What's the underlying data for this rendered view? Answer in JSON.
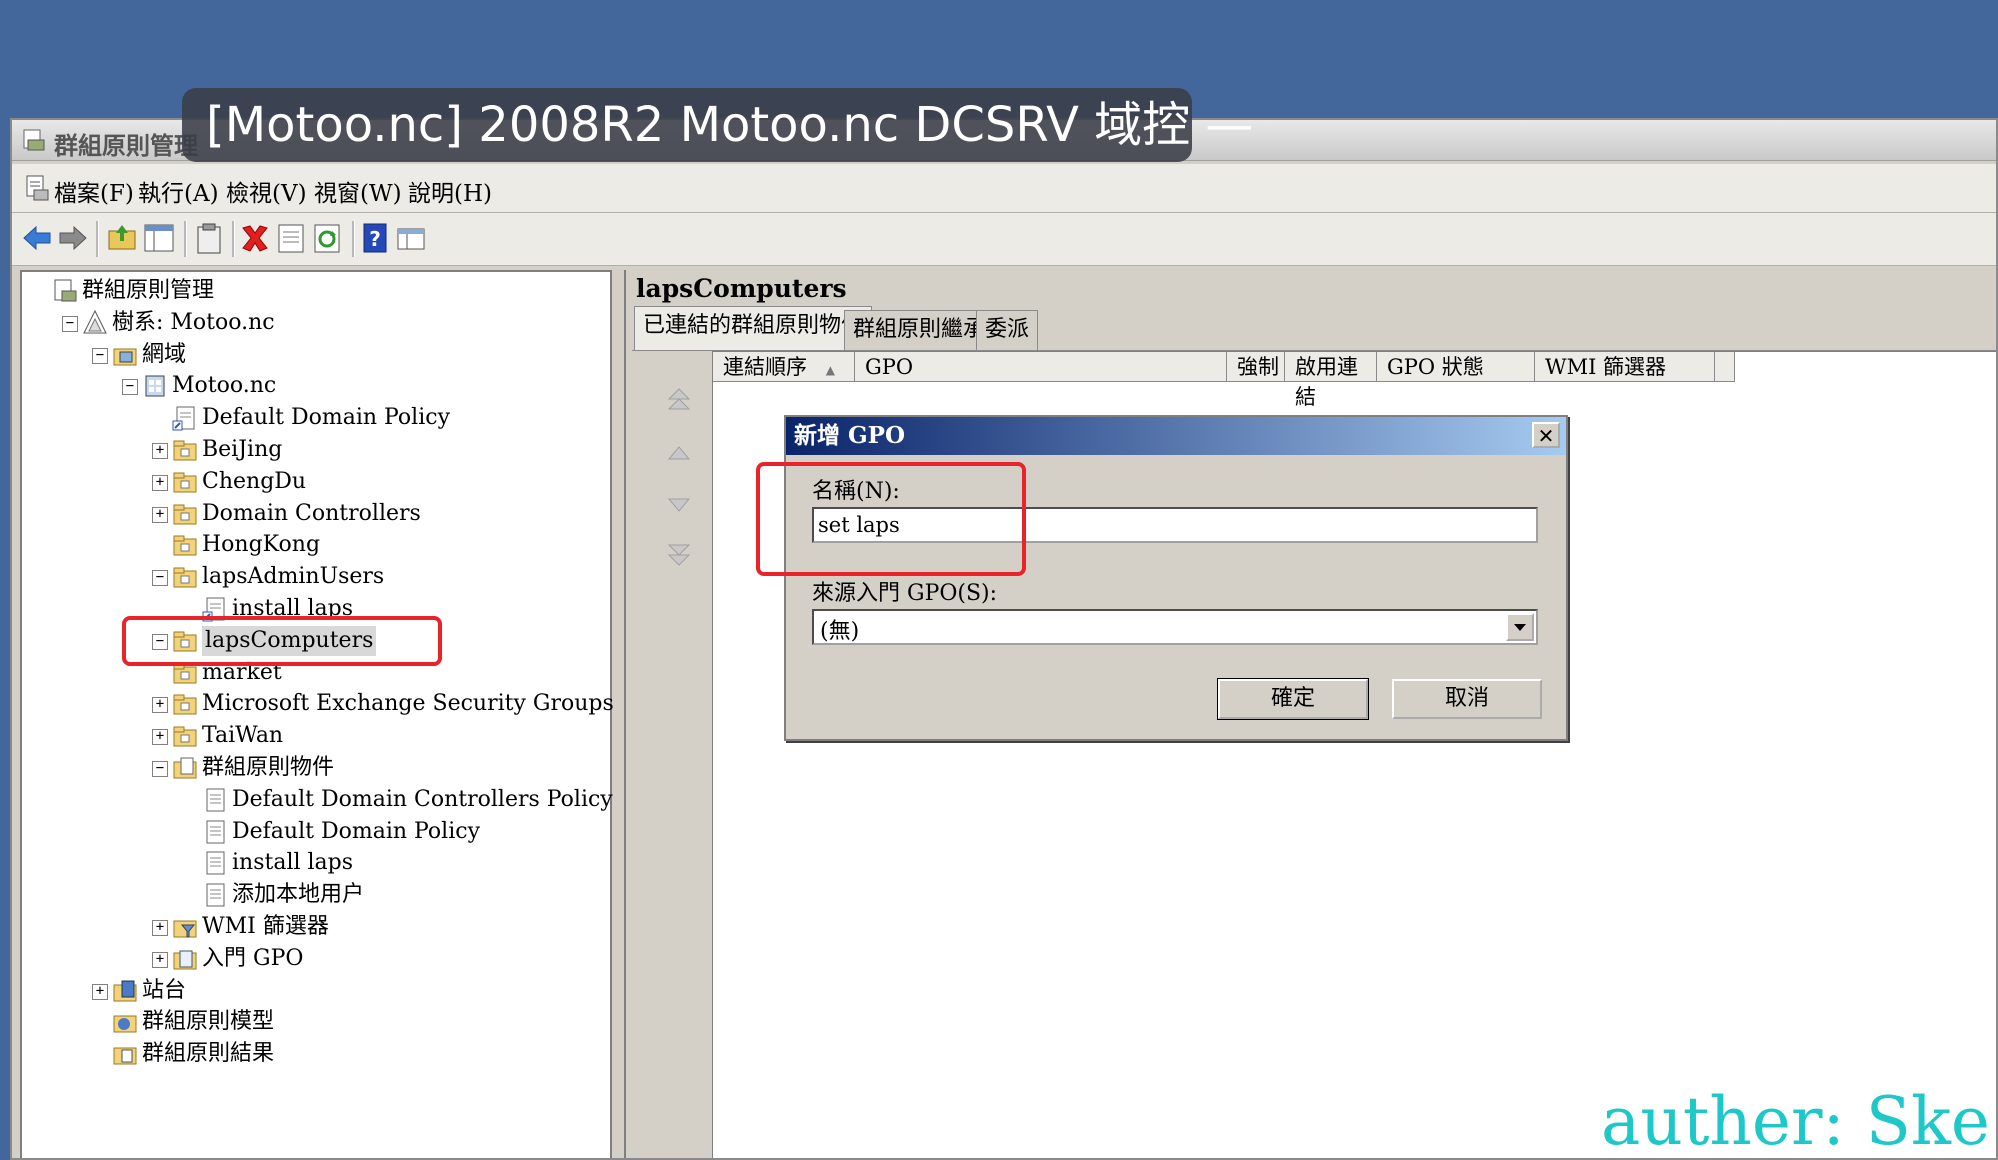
{
  "vm_banner": "[Motoo.nc] 2008R2 Motoo.nc DCSRV 域控 —",
  "window": {
    "title": "群組原則管理"
  },
  "menu": [
    "檔案(F)",
    "執行(A)",
    "檢視(V)",
    "視窗(W)",
    "說明(H)"
  ],
  "toolbar_icons": [
    "back-arrow-icon",
    "forward-arrow-icon",
    "up-folder-icon",
    "show-hide-tree-icon",
    "clipboard-icon",
    "delete-icon",
    "properties-icon",
    "refresh-icon",
    "help-icon",
    "view-icon"
  ],
  "tree": [
    {
      "label": "群組原則管理",
      "expander": "",
      "icon": "gpmc-root-icon"
    },
    {
      "label": "樹系: Motoo.nc",
      "expander": "−",
      "icon": "forest-icon"
    },
    {
      "label": "網域",
      "expander": "−",
      "icon": "domains-folder-icon"
    },
    {
      "label": "Motoo.nc",
      "expander": "−",
      "icon": "domain-icon"
    },
    {
      "label": "Default Domain Policy",
      "expander": "",
      "icon": "gpo-link-icon"
    },
    {
      "label": "BeiJing",
      "expander": "+",
      "icon": "ou-folder-icon"
    },
    {
      "label": "ChengDu",
      "expander": "+",
      "icon": "ou-folder-icon"
    },
    {
      "label": "Domain Controllers",
      "expander": "+",
      "icon": "ou-folder-icon"
    },
    {
      "label": "HongKong",
      "expander": "",
      "icon": "ou-folder-icon"
    },
    {
      "label": "lapsAdminUsers",
      "expander": "−",
      "icon": "ou-folder-icon"
    },
    {
      "label": "install laps",
      "expander": "",
      "icon": "gpo-link-icon"
    },
    {
      "label": "lapsComputers",
      "expander": "−",
      "icon": "ou-folder-icon"
    },
    {
      "label": "market",
      "expander": "",
      "icon": "ou-folder-icon"
    },
    {
      "label": "Microsoft Exchange Security Groups",
      "expander": "+",
      "icon": "ou-folder-icon"
    },
    {
      "label": "TaiWan",
      "expander": "+",
      "icon": "ou-folder-icon"
    },
    {
      "label": "群組原則物件",
      "expander": "−",
      "icon": "gpo-container-icon"
    },
    {
      "label": "Default Domain Controllers Policy",
      "expander": "",
      "icon": "gpo-icon"
    },
    {
      "label": "Default Domain Policy",
      "expander": "",
      "icon": "gpo-icon"
    },
    {
      "label": "install laps",
      "expander": "",
      "icon": "gpo-icon"
    },
    {
      "label": "添加本地用户",
      "expander": "",
      "icon": "gpo-icon"
    },
    {
      "label": "WMI 篩選器",
      "expander": "+",
      "icon": "wmi-filter-icon"
    },
    {
      "label": "入門 GPO",
      "expander": "+",
      "icon": "starter-gpo-icon"
    },
    {
      "label": "站台",
      "expander": "+",
      "icon": "sites-icon"
    },
    {
      "label": "群組原則模型",
      "expander": "",
      "icon": "modeling-icon"
    },
    {
      "label": "群組原則結果",
      "expander": "",
      "icon": "results-icon"
    }
  ],
  "right_pane": {
    "title": "lapsComputers",
    "tabs": [
      "已連結的群組原則物件",
      "群組原則繼承",
      "委派"
    ],
    "columns": [
      "連結順序",
      "GPO",
      "強制",
      "啟用連結",
      "GPO 狀態",
      "WMI 篩選器"
    ]
  },
  "dialog": {
    "title": "新增 GPO",
    "close": "✕",
    "name_label": "名稱(N):",
    "name_value": "set laps",
    "source_label": "來源入門 GPO(S):",
    "source_value": "(無)",
    "ok": "確定",
    "cancel": "取消"
  },
  "watermark": "auther: Ske",
  "colors": {
    "desktop": "#44679b",
    "annotation": "#e8232a",
    "watermark": "#1ec8c8",
    "dialog_title": "#0a246a"
  }
}
